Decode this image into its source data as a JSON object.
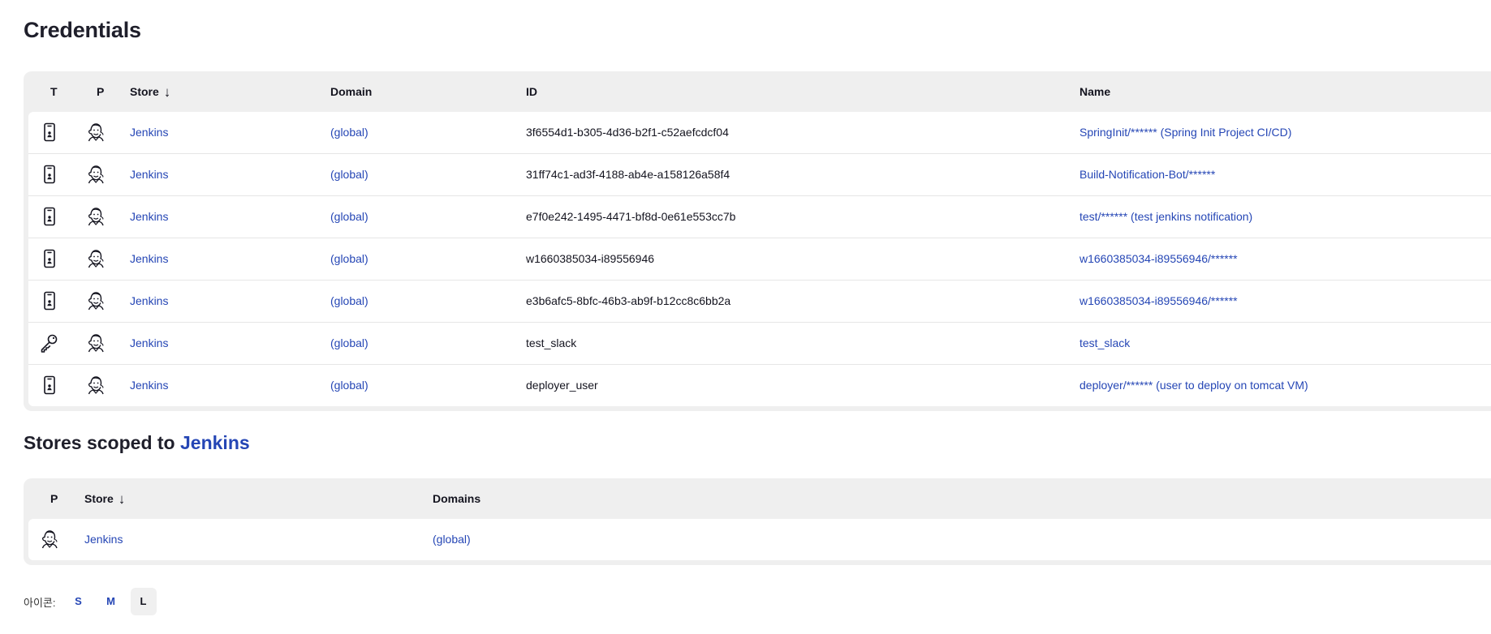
{
  "page_title": "Credentials",
  "credentials_table": {
    "headers": {
      "type": "T",
      "provider": "P",
      "store": "Store",
      "domain": "Domain",
      "id": "ID",
      "name": "Name"
    },
    "sort_indicator": "↓",
    "rows": [
      {
        "type_icon": "mobile-credential-icon",
        "provider_icon": "jenkins-icon",
        "store": "Jenkins",
        "domain": "(global)",
        "id": "3f6554d1-b305-4d36-b2f1-c52aefcdcf04",
        "name": "SpringInit/****** (Spring Init Project CI/CD)"
      },
      {
        "type_icon": "mobile-credential-icon",
        "provider_icon": "jenkins-icon",
        "store": "Jenkins",
        "domain": "(global)",
        "id": "31ff74c1-ad3f-4188-ab4e-a158126a58f4",
        "name": "Build-Notification-Bot/******"
      },
      {
        "type_icon": "mobile-credential-icon",
        "provider_icon": "jenkins-icon",
        "store": "Jenkins",
        "domain": "(global)",
        "id": "e7f0e242-1495-4471-bf8d-0e61e553cc7b",
        "name": "test/****** (test jenkins notification)"
      },
      {
        "type_icon": "mobile-credential-icon",
        "provider_icon": "jenkins-icon",
        "store": "Jenkins",
        "domain": "(global)",
        "id": "w1660385034-i89556946",
        "name": "w1660385034-i89556946/******"
      },
      {
        "type_icon": "mobile-credential-icon",
        "provider_icon": "jenkins-icon",
        "store": "Jenkins",
        "domain": "(global)",
        "id": "e3b6afc5-8bfc-46b3-ab9f-b12cc8c6bb2a",
        "name": "w1660385034-i89556946/******"
      },
      {
        "type_icon": "key-icon",
        "provider_icon": "jenkins-icon",
        "store": "Jenkins",
        "domain": "(global)",
        "id": "test_slack",
        "name": "test_slack"
      },
      {
        "type_icon": "mobile-credential-icon",
        "provider_icon": "jenkins-icon",
        "store": "Jenkins",
        "domain": "(global)",
        "id": "deployer_user",
        "name": "deployer/****** (user to deploy on tomcat VM)"
      }
    ]
  },
  "stores_section": {
    "title_prefix": "Stores scoped to",
    "title_link": "Jenkins",
    "headers": {
      "provider": "P",
      "store": "Store",
      "domains": "Domains"
    },
    "sort_indicator": "↓",
    "rows": [
      {
        "provider_icon": "jenkins-icon",
        "store": "Jenkins",
        "domains": "(global)"
      }
    ]
  },
  "icon_size": {
    "label": "아이콘:",
    "options": [
      "S",
      "M",
      "L"
    ],
    "selected": "L"
  },
  "colors": {
    "link": "#2546b5",
    "header_bg": "#efefef",
    "text": "#14141f"
  }
}
